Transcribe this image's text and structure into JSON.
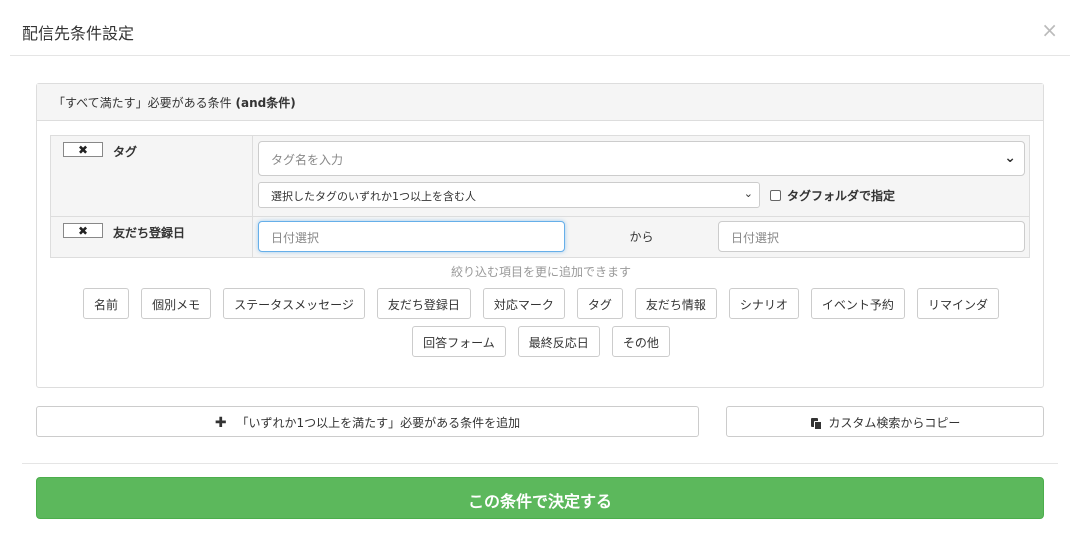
{
  "modal": {
    "title": "配信先条件設定",
    "close_glyph": "×"
  },
  "panel": {
    "heading_prefix": "「すべて満たす」必要がある条件",
    "heading_bold": "(and条件)"
  },
  "conditions": {
    "tag": {
      "remove_glyph": "✖",
      "label": "タグ",
      "input_placeholder": "タグ名を入力",
      "mode_selected": "選択したタグのいずれか1つ以上を含む人",
      "folder_checkbox_label": "タグフォルダで指定",
      "folder_checked": false
    },
    "friend_date": {
      "remove_glyph": "✖",
      "label": "友だち登録日",
      "from_placeholder": "日付選択",
      "connector": "から",
      "to_placeholder": "日付選択"
    }
  },
  "add_hint": "絞り込む項目を更に追加できます",
  "filter_chips_row1": [
    "名前",
    "個別メモ",
    "ステータスメッセージ",
    "友だち登録日",
    "対応マーク",
    "タグ",
    "友だち情報",
    "シナリオ",
    "イベント予約",
    "リマインダ"
  ],
  "filter_chips_row2": [
    "回答フォーム",
    "最終反応日",
    "その他"
  ],
  "buttons": {
    "add_or_condition": "「いずれか1つ以上を満たす」必要がある条件を追加",
    "copy_custom_search": "カスタム検索からコピー",
    "submit": "この条件で決定する"
  },
  "icons": {
    "remove": "x-icon",
    "dropdown": "chevron-down-icon",
    "add": "plus-icon",
    "copy": "copy-icon",
    "close": "close-icon"
  },
  "colors": {
    "submit_bg": "#5cb85c",
    "panel_heading_bg": "#f5f5f5",
    "focus_border": "#66afe9"
  }
}
